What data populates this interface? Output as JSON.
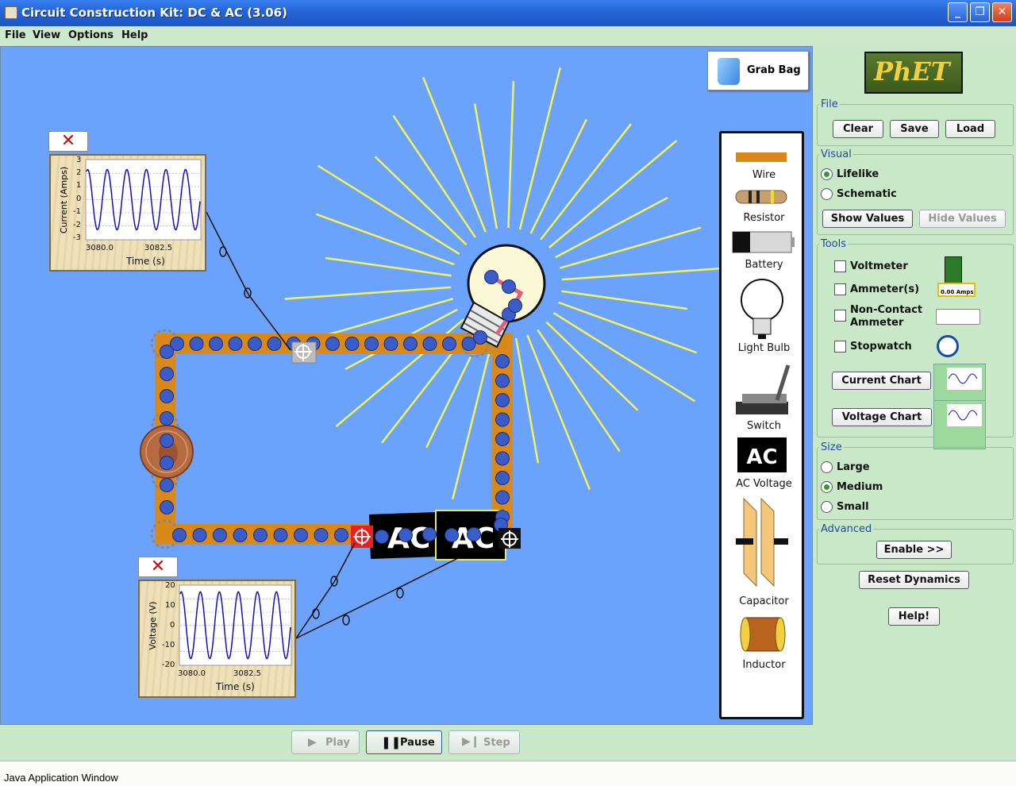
{
  "window": {
    "title": "Circuit Construction Kit: DC & AC (3.06)",
    "minimize": "_",
    "maximize": "❐",
    "close": "✕"
  },
  "menu": [
    "File",
    "View",
    "Options",
    "Help"
  ],
  "grab_bag": {
    "label": "Grab Bag"
  },
  "toolbox": {
    "items": [
      "Wire",
      "Resistor",
      "Battery",
      "Light Bulb",
      "Switch",
      "AC Voltage",
      "Capacitor",
      "Inductor"
    ],
    "ac_icon_text": "AC"
  },
  "current_chart": {
    "close": "✕",
    "ylabel": "Current (Amps)",
    "xlabel": "Time (s)",
    "yticks": [
      "3",
      "2",
      "1",
      "0",
      "-1",
      "-2",
      "-3"
    ],
    "xticks": [
      "3080.0",
      "3082.5"
    ],
    "ylim": [
      -3,
      3
    ]
  },
  "voltage_chart": {
    "close": "✕",
    "ylabel": "Voltage (V)",
    "xlabel": "Time (s)",
    "yticks": [
      "20",
      "10",
      "0",
      "-10",
      "-20"
    ],
    "xticks": [
      "3080.0",
      "3082.5"
    ],
    "ylim": [
      -20,
      20
    ]
  },
  "circuit": {
    "ac_label": "AC"
  },
  "controls": {
    "play": "Play",
    "pause": "Pause",
    "step": "Step"
  },
  "status": "Java Application Window",
  "panel": {
    "logo": "PhET",
    "file": {
      "title": "File",
      "clear": "Clear",
      "save": "Save",
      "load": "Load"
    },
    "visual": {
      "title": "Visual",
      "lifelike": "Lifelike",
      "schematic": "Schematic",
      "selected": "Lifelike",
      "show_values": "Show Values",
      "hide_values": "Hide Values"
    },
    "tools": {
      "title": "Tools",
      "voltmeter": "Voltmeter",
      "ammeter": "Ammeter(s)",
      "noncontact_1": "Non-Contact",
      "noncontact_2": "Ammeter",
      "stopwatch": "Stopwatch",
      "current_chart": "Current Chart",
      "voltage_chart": "Voltage Chart",
      "ammeter_readout": "0.00 Amps"
    },
    "size": {
      "title": "Size",
      "large": "Large",
      "medium": "Medium",
      "small": "Small",
      "selected": "Medium"
    },
    "advanced": {
      "title": "Advanced",
      "enable": "Enable >>"
    },
    "reset": "Reset Dynamics",
    "help": "Help!"
  },
  "colors": {
    "background": "#6aa2fc",
    "wire": "#d9891a",
    "electron": "#3a5cc8",
    "light_ray": "#f2f25a",
    "trace": "#1010c0"
  }
}
